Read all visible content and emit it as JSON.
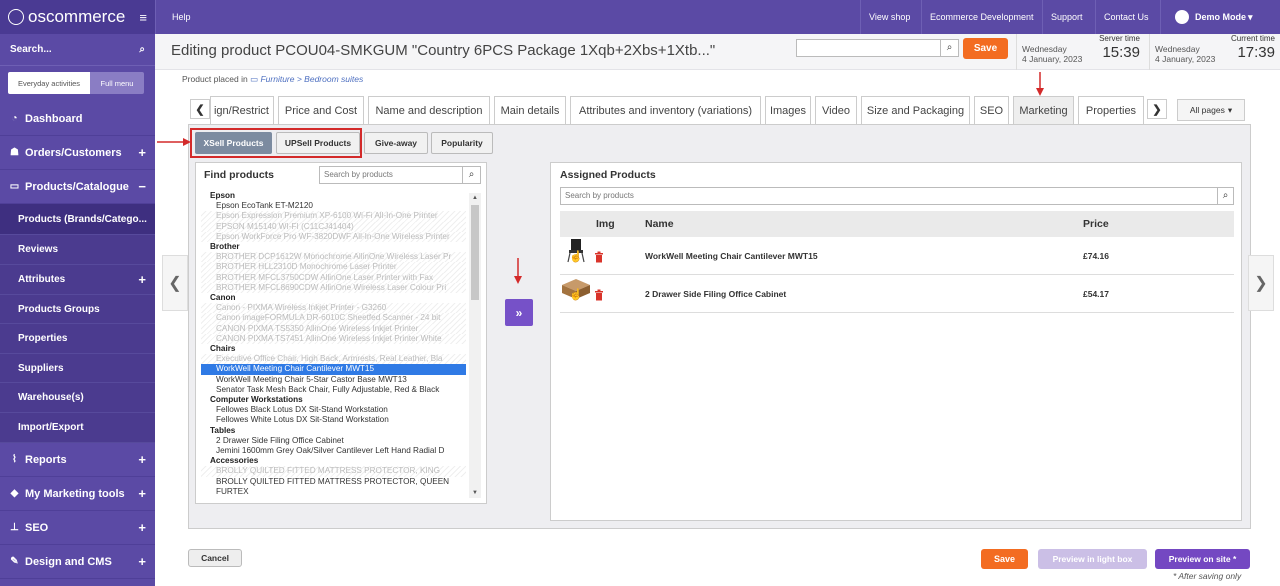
{
  "sidebar": {
    "logo": "oscommerce",
    "search_label": "Search...",
    "tab_everyday": "Everyday activities",
    "tab_full": "Full menu",
    "items": {
      "dashboard": "Dashboard",
      "orders": "Orders/Customers",
      "products": "Products/Catalogue",
      "sub_products": "Products (Brands/Catego...",
      "sub_reviews": "Reviews",
      "sub_attributes": "Attributes",
      "sub_groups": "Products Groups",
      "sub_properties": "Properties",
      "sub_suppliers": "Suppliers",
      "sub_warehouses": "Warehouse(s)",
      "sub_import": "Import/Export",
      "reports": "Reports",
      "marketing": "My Marketing tools",
      "seo": "SEO",
      "design": "Design and CMS"
    }
  },
  "topbar": {
    "help": "Help",
    "view_shop": "View shop",
    "ecommerce": "Ecommerce Development",
    "support": "Support",
    "contact": "Contact Us",
    "user": "Demo Mode"
  },
  "header": {
    "title": "Editing product PCOU04-SMKGUM \"Country 6PCS Package 1Xqb+2Xbs+1Xtb...\"",
    "save": "Save",
    "server_time_label": "Server time",
    "server_day": "Wednesday",
    "server_date": "4 January, 2023",
    "server_clock": "15:39",
    "current_time_label": "Current time",
    "current_day": "Wednesday",
    "current_date": "4 January, 2023",
    "current_clock": "17:39"
  },
  "breadcrumb": {
    "prefix": "Product placed in",
    "path": "Furniture > Bedroom suites"
  },
  "tabs": {
    "t1": "ign/Restrict",
    "t2": "Price and Cost",
    "t3": "Name and description",
    "t4": "Main details",
    "t5": "Attributes and inventory (variations)",
    "t6": "Images",
    "t7": "Video",
    "t8": "Size and Packaging",
    "t9": "SEO",
    "t10": "Marketing",
    "t11": "Properties",
    "all_pages": "All pages"
  },
  "subtabs": {
    "xsell": "XSell Products",
    "upsell": "UPSell Products",
    "giveaway": "Give-away",
    "popularity": "Popularity"
  },
  "find": {
    "title": "Find products",
    "placeholder": "Search by products",
    "list": [
      {
        "t": "Epson",
        "k": "grp"
      },
      {
        "t": "Epson EcoTank ET-M2120",
        "k": "item"
      },
      {
        "t": "Epson Expression Premium XP-6100 Wi-Fi All-In-One Printer",
        "k": "dis"
      },
      {
        "t": "EPSON M15140 WI-FI (C11CJ41404)",
        "k": "dis"
      },
      {
        "t": "Epson WorkForce Pro WF-3820DWF All-In-One Wireless Printer",
        "k": "dis"
      },
      {
        "t": "Brother",
        "k": "grp"
      },
      {
        "t": "BROTHER DCP1612W Monochrome AllinOne Wireless Laser Pr",
        "k": "dis"
      },
      {
        "t": "BROTHER HLL2310D Monochrome Laser Printer",
        "k": "dis"
      },
      {
        "t": "BROTHER MFCL3750CDW AllinOne Laser Printer with Fax",
        "k": "dis"
      },
      {
        "t": "BROTHER MFCL8690CDW AllinOne Wireless Laser Colour Pri",
        "k": "dis"
      },
      {
        "t": "Canon",
        "k": "grp"
      },
      {
        "t": "Canon - PIXMA Wireless Inkjet Printer - G3260",
        "k": "dis"
      },
      {
        "t": "Canon imageFORMULA DR-6010C Sheetfed Scanner - 24 bit",
        "k": "dis"
      },
      {
        "t": "CANON PIXMA TS5350 AllinOne Wireless Inkjet Printer",
        "k": "dis"
      },
      {
        "t": "CANON PIXMA TS7451 AllinOne Wireless Inkjet Printer White",
        "k": "dis"
      },
      {
        "t": "Chairs",
        "k": "grp"
      },
      {
        "t": "Executive Office Chair, High Back, Armrests, Real Leather, Bla",
        "k": "dis"
      },
      {
        "t": "WorkWell Meeting Chair Cantilever MWT15",
        "k": "sel"
      },
      {
        "t": "WorkWell Meeting Chair 5-Star Castor Base MWT13",
        "k": "item"
      },
      {
        "t": "Senator Task Mesh Back Chair, Fully Adjustable, Red & Black",
        "k": "item"
      },
      {
        "t": "Computer Workstations",
        "k": "grp"
      },
      {
        "t": "Fellowes Black Lotus DX Sit-Stand Workstation",
        "k": "item"
      },
      {
        "t": "Fellowes White Lotus DX Sit-Stand Workstation",
        "k": "item"
      },
      {
        "t": "Tables",
        "k": "grp"
      },
      {
        "t": "2 Drawer Side Filing Office Cabinet",
        "k": "item"
      },
      {
        "t": "Jemini 1600mm Grey Oak/Silver Cantilever Left Hand Radial D",
        "k": "item"
      },
      {
        "t": "Accessories",
        "k": "grp"
      },
      {
        "t": "BROLLY QUILTED FITTED MATTRESS PROTECTOR, KING",
        "k": "dis"
      },
      {
        "t": "BROLLY QUILTED FITTED MATTRESS PROTECTOR, QUEEN",
        "k": "item"
      },
      {
        "t": "FURTEX",
        "k": "item"
      }
    ]
  },
  "assigned": {
    "title": "Assigned Products",
    "placeholder": "Search by products",
    "headers": {
      "img": "Img",
      "name": "Name",
      "price": "Price"
    },
    "rows": [
      {
        "name": "WorkWell Meeting Chair Cantilever MWT15",
        "price": "£74.16"
      },
      {
        "name": "2 Drawer Side Filing Office Cabinet",
        "price": "£54.17"
      }
    ]
  },
  "footer": {
    "cancel": "Cancel",
    "save": "Save",
    "preview_light": "Preview in light box",
    "preview_site": "Preview on site *",
    "note": "* After saving only"
  },
  "colors": {
    "accent": "#5b4aa5",
    "orange": "#f36c21",
    "highlight": "#d32a2a"
  }
}
